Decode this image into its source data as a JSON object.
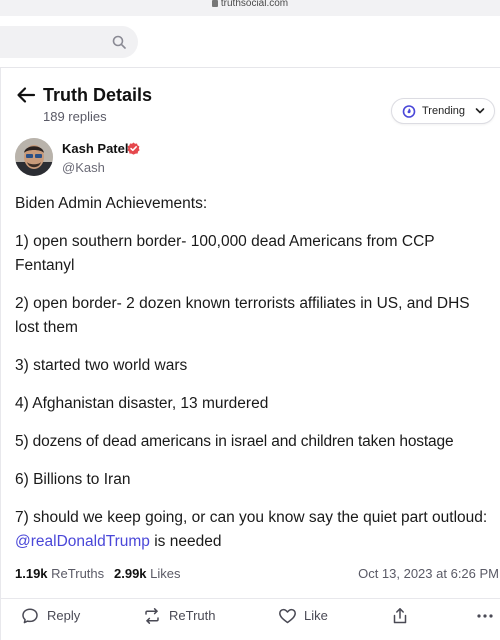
{
  "browser": {
    "url": "truthsocial.com"
  },
  "search": {
    "icon": "search-icon"
  },
  "header": {
    "title": "Truth Details",
    "reply_count": "189 replies",
    "trending_label": "Trending"
  },
  "post": {
    "author": {
      "name": "Kash Patel",
      "handle": "@Kash",
      "verified": true
    },
    "paragraphs": [
      {
        "text": "Biden Admin Achievements:"
      },
      {
        "text": "1) open southern border- 100,000 dead Americans from CCP Fentanyl"
      },
      {
        "text": "2) open border- 2 dozen known terrorists affiliates in US, and DHS lost them"
      },
      {
        "text": "3) started two world wars"
      },
      {
        "text": "4) Afghanistan disaster, 13 murdered"
      },
      {
        "text": "5) dozens of dead americans in israel and children taken hostage"
      },
      {
        "text": "6) Billions to Iran"
      },
      {
        "text": "7) should we keep going, or can you know say the quiet part outloud: ",
        "mention": "@realDonaldTrump",
        "suffix": " is needed"
      }
    ],
    "stats": {
      "retruths_count": "1.19k",
      "retruths_label": "ReTruths",
      "likes_count": "2.99k",
      "likes_label": "Likes",
      "timestamp": "Oct 13, 2023 at 6:26 PM"
    }
  },
  "actions": {
    "reply_label": "Reply",
    "retruth_label": "ReTruth",
    "like_label": "Like"
  },
  "colors": {
    "accent": "#4a47d8",
    "verified": "#e5484d",
    "trending_icon": "#4a47d8"
  }
}
